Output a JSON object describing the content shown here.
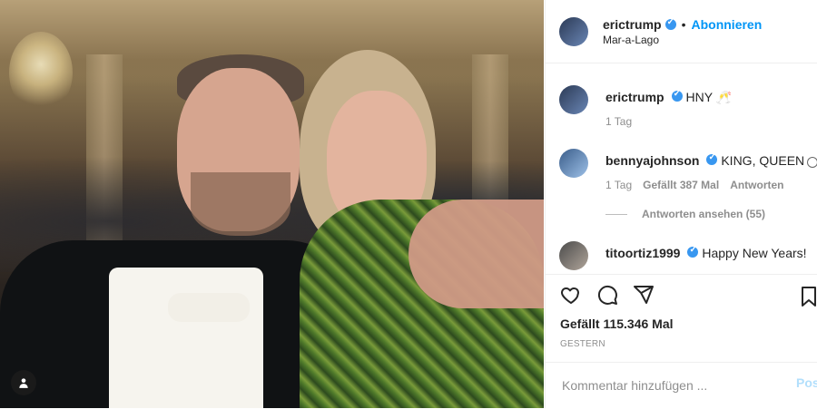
{
  "post": {
    "username": "erictrump",
    "follow_label": "Abonnieren",
    "location": "Mar-a-Lago",
    "caption_user": "erictrump",
    "caption": "HNY 🥂",
    "caption_age": "1 Tag",
    "likes": "Gefällt 115.346 Mal",
    "timestamp": "GESTERN"
  },
  "comments": [
    {
      "username": "bennyajohnson",
      "text": "KING, QUEEN",
      "age": "1 Tag",
      "likes": "Gefällt 387 Mal",
      "reply": "Antworten",
      "view_replies": "Antworten ansehen (55)"
    },
    {
      "username": "titoortiz1999",
      "text": "Happy New Years!"
    }
  ],
  "comment_input": {
    "placeholder": "Kommentar hinzufügen ...",
    "post_label": "Post"
  },
  "colors": {
    "accent": "#0095f6",
    "verified": "#3897f0",
    "text": "#262626",
    "muted": "#8e8e8e"
  }
}
